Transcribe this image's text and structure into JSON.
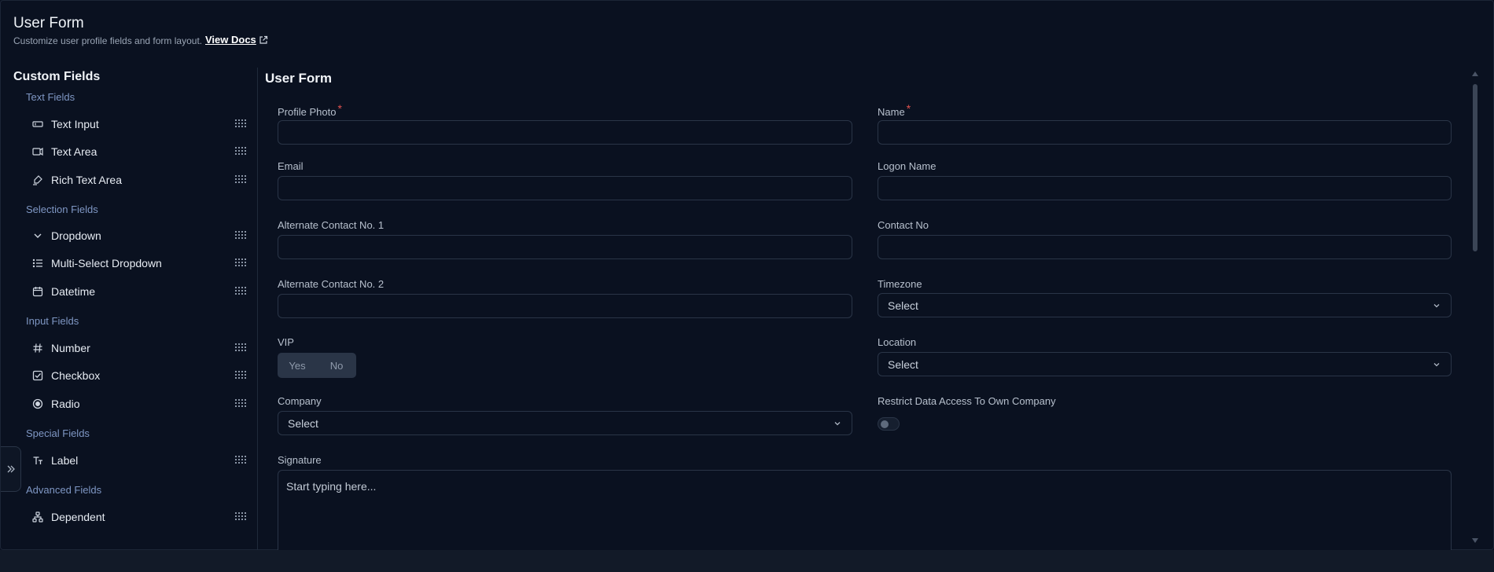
{
  "header": {
    "title": "User Form",
    "subtitle": "Customize user profile fields and form layout.",
    "docs_link": "View Docs"
  },
  "sidebar": {
    "title": "Custom Fields",
    "sections": {
      "text": "Text Fields",
      "selection": "Selection Fields",
      "input": "Input Fields",
      "special": "Special Fields",
      "advanced": "Advanced Fields"
    },
    "items": {
      "text_input": "Text Input",
      "text_area": "Text Area",
      "rich_text_area": "Rich Text Area",
      "dropdown": "Dropdown",
      "multi_select": "Multi-Select Dropdown",
      "datetime": "Datetime",
      "number": "Number",
      "checkbox": "Checkbox",
      "radio": "Radio",
      "label": "Label",
      "dependent": "Dependent"
    }
  },
  "form": {
    "title": "User Form",
    "required_mark": "*",
    "fields": {
      "profile_photo": "Profile Photo",
      "name": "Name",
      "email": "Email",
      "logon_name": "Logon Name",
      "alt_contact_1": "Alternate Contact No. 1",
      "contact_no": "Contact No",
      "alt_contact_2": "Alternate Contact No. 2",
      "timezone": "Timezone",
      "vip": "VIP",
      "location": "Location",
      "company": "Company",
      "restrict": "Restrict Data Access To Own Company",
      "signature": "Signature"
    },
    "select_placeholder": "Select",
    "vip_yes": "Yes",
    "vip_no": "No",
    "signature_placeholder": "Start typing here..."
  }
}
